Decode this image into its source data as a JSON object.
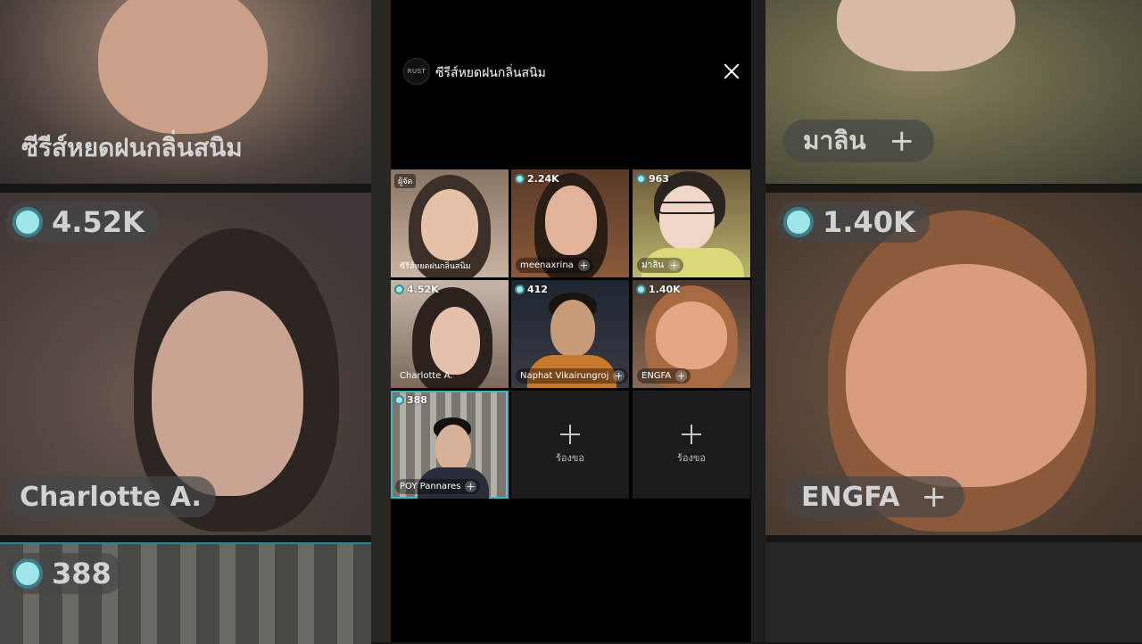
{
  "room": {
    "host_name": "ซีรีส์หยดฝนกลิ่นสนิม",
    "host_tag": "ผู้จัด",
    "logo_text": "RUST"
  },
  "participants": [
    {
      "name": "ซีรีส์หยดฝนกลิ่นสนิม",
      "count": null,
      "host": true
    },
    {
      "name": "meenaxrina",
      "count": "2.24K"
    },
    {
      "name": "มาลิน",
      "count": "963"
    },
    {
      "name": "Charlotte A.",
      "count": "4.52K"
    },
    {
      "name": "Naphat Vikairungroj",
      "count": "412"
    },
    {
      "name": "ENGFA",
      "count": "1.40K"
    },
    {
      "name": "POY Pannares",
      "count": "388",
      "selected": true
    }
  ],
  "empty_slots": [
    {
      "label": "ร้องขอ"
    },
    {
      "label": "ร้องขอ"
    }
  ],
  "background": {
    "left_top_name": "ซีรีส์หยดฝนกลิ่นสนิม",
    "left_mid_count": "4.52K",
    "left_mid_name": "Charlotte A.",
    "left_bottom_count": "388",
    "right_top_name": "มาลิน",
    "right_mid_count": "1.40K",
    "right_mid_name": "ENGFA"
  },
  "colors": {
    "accent": "#35b9c6",
    "coin": "#9ee6ea"
  }
}
